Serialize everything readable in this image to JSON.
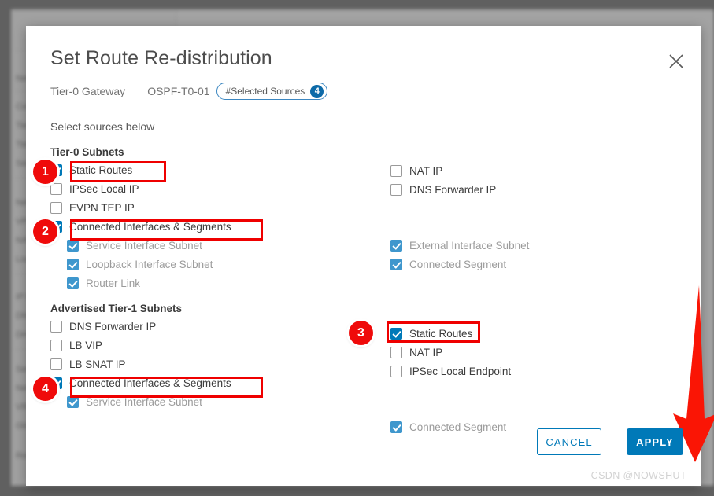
{
  "modal": {
    "title": "Set Route Re-distribution",
    "close_icon": "close-icon",
    "subtitle": {
      "gateway_label": "Tier-0 Gateway",
      "gateway_name": "OSPF-T0-01",
      "chip_label": "#Selected Sources",
      "chip_count": "4"
    },
    "select_hint": "Select sources below"
  },
  "sections": {
    "tier0": {
      "title": "Tier-0 Subnets",
      "left_rows": [
        {
          "label": "Static Routes",
          "checked": true,
          "disabled": false,
          "indent": false
        },
        {
          "label": "IPSec Local IP",
          "checked": false,
          "disabled": false,
          "indent": false
        },
        {
          "label": "EVPN TEP IP",
          "checked": false,
          "disabled": false,
          "indent": false
        },
        {
          "label": "Connected Interfaces & Segments",
          "checked": true,
          "disabled": false,
          "indent": false
        },
        {
          "label": "Service Interface Subnet",
          "checked": true,
          "disabled": true,
          "indent": true
        },
        {
          "label": "Loopback Interface Subnet",
          "checked": true,
          "disabled": true,
          "indent": true
        },
        {
          "label": "Router Link",
          "checked": true,
          "disabled": true,
          "indent": true
        }
      ],
      "right_rows": [
        {
          "label": "NAT IP",
          "checked": false,
          "disabled": false,
          "indent": false
        },
        {
          "label": "DNS Forwarder IP",
          "checked": false,
          "disabled": false,
          "indent": false
        },
        {
          "label": "External Interface Subnet",
          "checked": true,
          "disabled": true,
          "indent": false
        },
        {
          "label": "Connected Segment",
          "checked": true,
          "disabled": true,
          "indent": false
        }
      ]
    },
    "tier1": {
      "title": "Advertised Tier-1 Subnets",
      "left_rows": [
        {
          "label": "DNS Forwarder IP",
          "checked": false,
          "disabled": false,
          "indent": false
        },
        {
          "label": "LB VIP",
          "checked": false,
          "disabled": false,
          "indent": false
        },
        {
          "label": "LB SNAT IP",
          "checked": false,
          "disabled": false,
          "indent": false
        },
        {
          "label": "Connected Interfaces & Segments",
          "checked": true,
          "disabled": false,
          "indent": false
        },
        {
          "label": "Service Interface Subnet",
          "checked": true,
          "disabled": true,
          "indent": true
        }
      ],
      "right_rows": [
        {
          "label": "Static Routes",
          "checked": true,
          "disabled": false,
          "indent": false
        },
        {
          "label": "NAT IP",
          "checked": false,
          "disabled": false,
          "indent": false
        },
        {
          "label": "IPSec Local Endpoint",
          "checked": false,
          "disabled": false,
          "indent": false
        },
        {
          "label": "Connected Segment",
          "checked": true,
          "disabled": true,
          "indent": false
        }
      ]
    }
  },
  "annotations": {
    "badges": [
      {
        "number": "1"
      },
      {
        "number": "2"
      },
      {
        "number": "3"
      },
      {
        "number": "4"
      }
    ],
    "arrow_color": "#fa1505",
    "highlight_color": "#ef0000"
  },
  "footer": {
    "cancel_label": "CANCEL",
    "apply_label": "APPLY",
    "watermark": "CSDN @NOWSHUT"
  },
  "colors": {
    "accent": "#0079b8",
    "chip_border": "#3c87c1",
    "badge_blue": "#0d6aa8"
  }
}
